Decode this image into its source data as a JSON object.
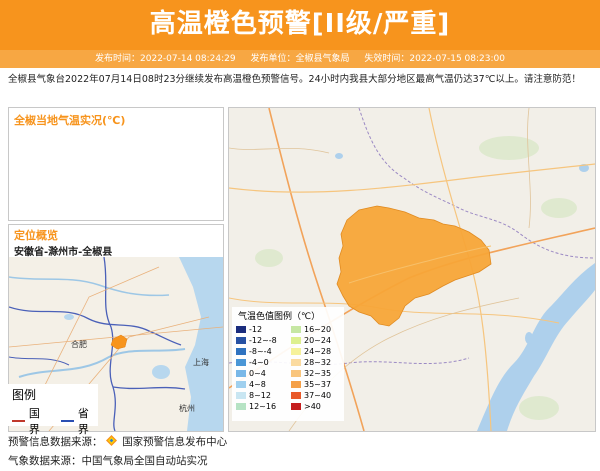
{
  "banner": {
    "title": "高温橙色预警[II级/严重]",
    "color": "#f7941d"
  },
  "meta": {
    "publish_time": "发布时间：2022-07-14 08:24:29",
    "publisher": "发布单位：全椒县气象局",
    "expire_time": "失效时间：2022-07-15 08:23:00"
  },
  "description": "全椒县气象台2022年07月14日08时23分继续发布高温橙色预警信号。24小时内我县大部分地区最高气温仍达37℃以上。请注意防范！",
  "observation": {
    "title": "全椒当地气温实况(℃)"
  },
  "location": {
    "title": "定位概览",
    "path": "安徽省-滁州市-全椒县",
    "cities": [
      "合肥",
      "上海",
      "杭州"
    ],
    "legend": {
      "title": "图例",
      "national_border": "国界",
      "provincial_border": "省界"
    }
  },
  "temp_legend": {
    "title": "气温色值图例（℃）",
    "items": [
      {
        "label": "-12",
        "color": "#1a2c7d"
      },
      {
        "label": "16~20",
        "color": "#c6e7a3"
      },
      {
        "label": "-12~-8",
        "color": "#2751a3"
      },
      {
        "label": "20~24",
        "color": "#ddf08f"
      },
      {
        "label": "-8~-4",
        "color": "#2f73c0"
      },
      {
        "label": "24~28",
        "color": "#f6f29b"
      },
      {
        "label": "-4~0",
        "color": "#4a96d6"
      },
      {
        "label": "28~32",
        "color": "#fbdba0"
      },
      {
        "label": "0~4",
        "color": "#79b8e8"
      },
      {
        "label": "32~35",
        "color": "#f9c57c"
      },
      {
        "label": "4~8",
        "color": "#9fd0ef"
      },
      {
        "label": "35~37",
        "color": "#f5a047"
      },
      {
        "label": "8~12",
        "color": "#c9e6f2"
      },
      {
        "label": "37~40",
        "color": "#e9592a"
      },
      {
        "label": "12~16",
        "color": "#b6e3c4"
      },
      {
        "label": ">40",
        "color": "#c41e1e"
      }
    ]
  },
  "footer": {
    "warning_source": "预警信息数据来源：",
    "warning_source_name": "国家预警信息发布中心",
    "weather_source": "气象数据来源：中国气象局全国自动站实况"
  }
}
